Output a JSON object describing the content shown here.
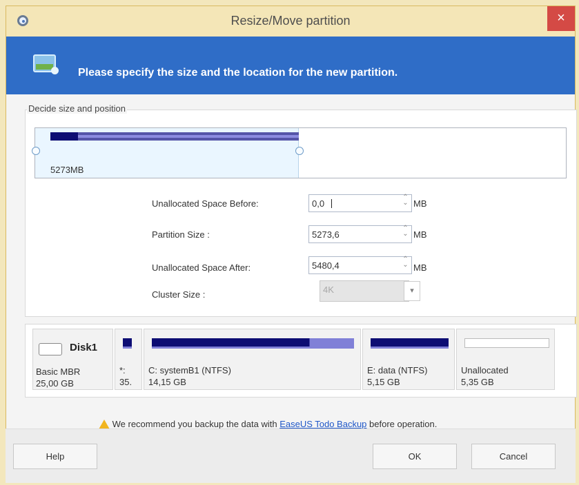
{
  "window": {
    "title": "Resize/Move partition",
    "close_label": "×"
  },
  "banner": {
    "text": "Please specify the size and the location for the new partition."
  },
  "group": {
    "label": "Decide size and position",
    "map_label": "5273MB"
  },
  "fields": {
    "before_label": "Unallocated Space Before:",
    "before_value": "0,0",
    "partition_label": "Partition Size :",
    "partition_value": "5273,6",
    "after_label": "Unallocated Space After:",
    "after_value": "5480,4",
    "cluster_label": "Cluster Size :",
    "cluster_value": "4K",
    "unit": "MB"
  },
  "disk": {
    "name": "Disk1",
    "type": "Basic MBR",
    "size": "25,00 GB"
  },
  "partitions": [
    {
      "label": "*:",
      "size": "35."
    },
    {
      "label": "C: systemB1 (NTFS)",
      "size": "14,15 GB"
    },
    {
      "label": "E: data (NTFS)",
      "size": "5,15 GB"
    },
    {
      "label": "Unallocated",
      "size": "5,35 GB"
    }
  ],
  "warning": {
    "before": "We recommend you backup the data with ",
    "link": "EaseUS Todo Backup",
    "after": " before operation."
  },
  "buttons": {
    "help": "Help",
    "ok": "OK",
    "cancel": "Cancel"
  },
  "icons": {
    "app": "disk-partition-app-icon",
    "banner": "partition-image-icon",
    "warning": "warning-icon",
    "disk": "disk-icon",
    "spinner": "spinner-icon",
    "dropdown": "chevron-down-icon"
  },
  "colors": {
    "banner": "#2f6dc7",
    "partition_primary": "#0d0d73",
    "partition_secondary": "#8080d7",
    "close": "#d44a45"
  }
}
